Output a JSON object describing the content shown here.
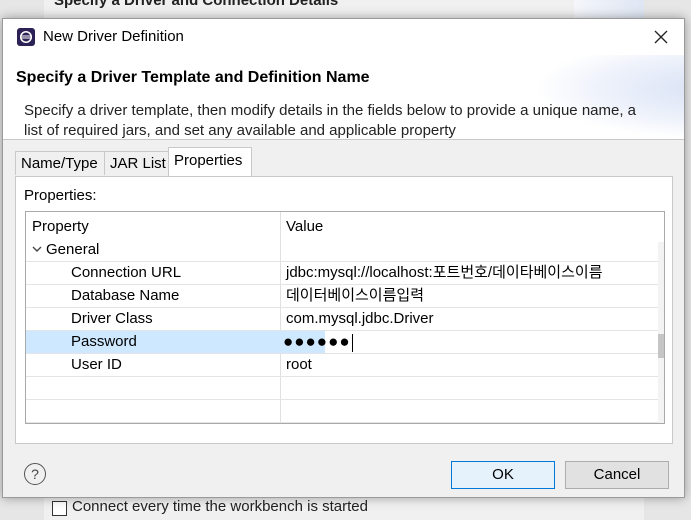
{
  "background": {
    "parent_title": "Specify a Driver and Connection Details",
    "bottom_checkbox_label": "Connect every time the workbench is started"
  },
  "dialog": {
    "title": "New Driver Definition",
    "header_title": "Specify a Driver Template and Definition Name",
    "header_description": "Specify a driver template, then modify details in the fields below to provide a unique name, a list of required jars, and set any available and applicable property"
  },
  "tabs": [
    {
      "label": "Name/Type",
      "active": false
    },
    {
      "label": "JAR List",
      "active": false
    },
    {
      "label": "Properties",
      "active": true
    }
  ],
  "properties_panel": {
    "label": "Properties:",
    "columns": [
      "Property",
      "Value"
    ],
    "group": {
      "label": "General",
      "expanded": true
    },
    "rows": [
      {
        "property": "Connection URL",
        "value": "jdbc:mysql://localhost:포트번호/데이타베이스이름"
      },
      {
        "property": "Database Name",
        "value": "데이터베이스이름입력"
      },
      {
        "property": "Driver Class",
        "value": "com.mysql.jdbc.Driver"
      },
      {
        "property": "Password",
        "value": "●●●●●●",
        "selected": true
      },
      {
        "property": "User ID",
        "value": "root"
      }
    ]
  },
  "buttons": {
    "help": "?",
    "ok": "OK",
    "cancel": "Cancel"
  },
  "icons": {
    "app": "eclipse-icon",
    "close": "close-icon",
    "help": "help-icon",
    "expand": "chevron-down-icon"
  },
  "colors": {
    "selection": "#cde8ff",
    "default_button_border": "#0078d7"
  }
}
